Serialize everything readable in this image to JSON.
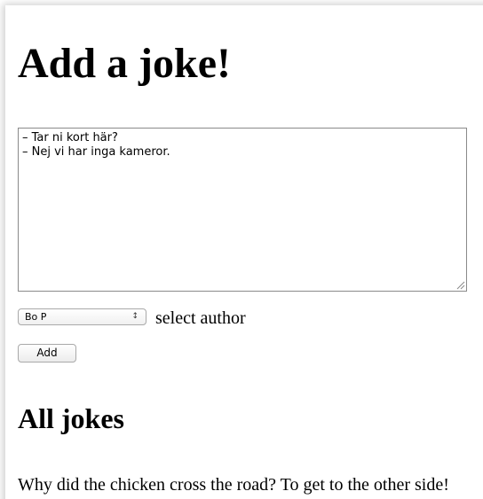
{
  "page": {
    "title": "Add a joke!"
  },
  "form": {
    "joke_text": "– Tar ni kort här?\n– Nej vi har inga kameror.",
    "author_selected": "Bo P",
    "author_label": "select author",
    "add_label": "Add"
  },
  "jokes": {
    "heading": "All jokes",
    "items": [
      "Why did the chicken cross the road? To get to the other side!"
    ]
  }
}
